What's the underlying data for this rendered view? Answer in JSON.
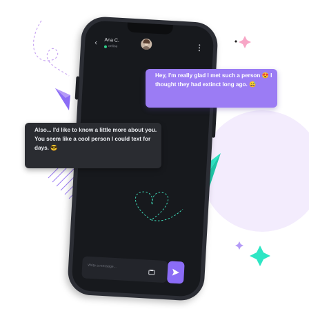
{
  "chat": {
    "contact_name": "Ana C.",
    "contact_status": "online",
    "avatar_alt": "Contact avatar"
  },
  "messages": {
    "outgoing": "Hey, I'm really glad I met such a person 😍 I thought they had extinct long ago. 😅",
    "incoming": "Also... I'd like to know a little more about you. You seem like a cool person I could text for days. 😎"
  },
  "composer": {
    "placeholder": "Write a message..."
  },
  "colors": {
    "accent": "#8b6cf6",
    "outgoing_bubble": "#9b7cf4",
    "incoming_bubble": "#2a2c31",
    "screen_bg": "#17191d",
    "online": "#2fd38b",
    "teal_plane": "#2ee6c4",
    "lavender_circle": "#f3ecfd"
  },
  "icons": {
    "back": "chevron-left-icon",
    "menu": "vertical-dots-icon",
    "attach": "attachment-icon",
    "send": "send-icon"
  }
}
